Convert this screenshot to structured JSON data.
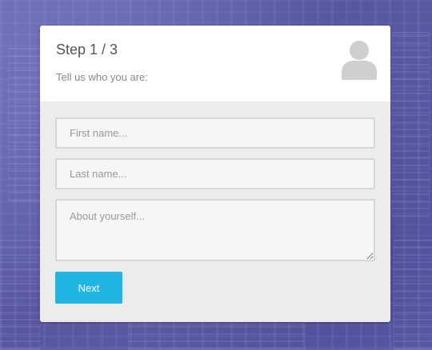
{
  "wizard": {
    "step_title": "Step 1 / 3",
    "subtitle": "Tell us who you are:",
    "avatar_icon": "user-icon"
  },
  "form": {
    "first_name": {
      "placeholder": "First name...",
      "value": ""
    },
    "last_name": {
      "placeholder": "Last name...",
      "value": ""
    },
    "about": {
      "placeholder": "About yourself...",
      "value": ""
    },
    "next_label": "Next"
  },
  "colors": {
    "background": "#5f5ea8",
    "accent": "#22b5e3",
    "card_body": "#ececec"
  }
}
